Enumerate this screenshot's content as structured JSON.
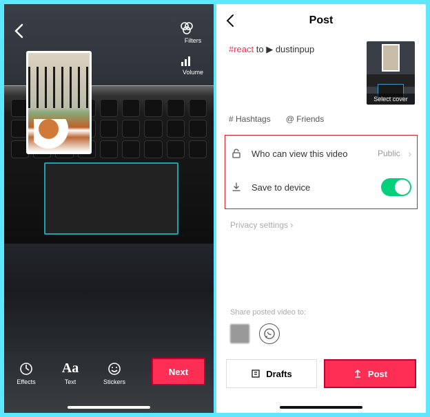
{
  "left": {
    "filters_label": "Filters",
    "volume_label": "Volume",
    "effects_label": "Effects",
    "text_label": "Text",
    "stickers_label": "Stickers",
    "next_label": "Next"
  },
  "right": {
    "title": "Post",
    "caption_prefix": "#react",
    "caption_to": " to  ▶ ",
    "caption_user": "dustinpup",
    "cover_label": "Select cover",
    "hashtags_label": "# Hashtags",
    "friends_label": "@ Friends",
    "view_label": "Who can view this video",
    "view_value": "Public",
    "save_label": "Save to device",
    "save_on": true,
    "privacy_label": "Privacy settings  ›",
    "share_label": "Share posted video to:",
    "drafts_label": "Drafts",
    "post_label": "Post"
  }
}
